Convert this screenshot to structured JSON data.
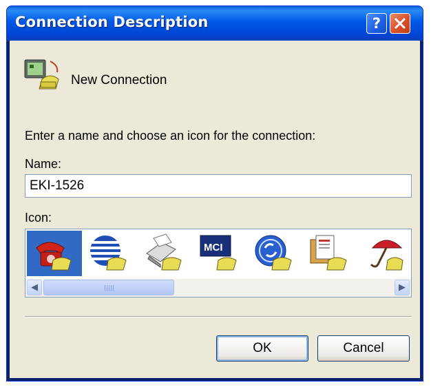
{
  "window": {
    "title": "Connection Description",
    "help_glyph": "?",
    "close_icon": "close-icon"
  },
  "header": {
    "icon": "new-connection-icon",
    "label": "New Connection"
  },
  "form": {
    "prompt": "Enter a name and choose an icon for the connection:",
    "name_label": "Name:",
    "name_value": "EKI-1526",
    "icon_label": "Icon:"
  },
  "icons": [
    {
      "name": "red-telephone-icon",
      "selected": true
    },
    {
      "name": "globe-lines-icon",
      "selected": false
    },
    {
      "name": "fax-machine-icon",
      "selected": false
    },
    {
      "name": "mci-logo-icon",
      "selected": false
    },
    {
      "name": "ge-logo-icon",
      "selected": false
    },
    {
      "name": "documents-icon",
      "selected": false
    },
    {
      "name": "umbrella-icon",
      "selected": false
    }
  ],
  "buttons": {
    "ok": "OK",
    "cancel": "Cancel"
  },
  "colors": {
    "title_bar": "#0054e3",
    "selection": "#316ac5",
    "dialog_bg": "#ece9d8"
  }
}
